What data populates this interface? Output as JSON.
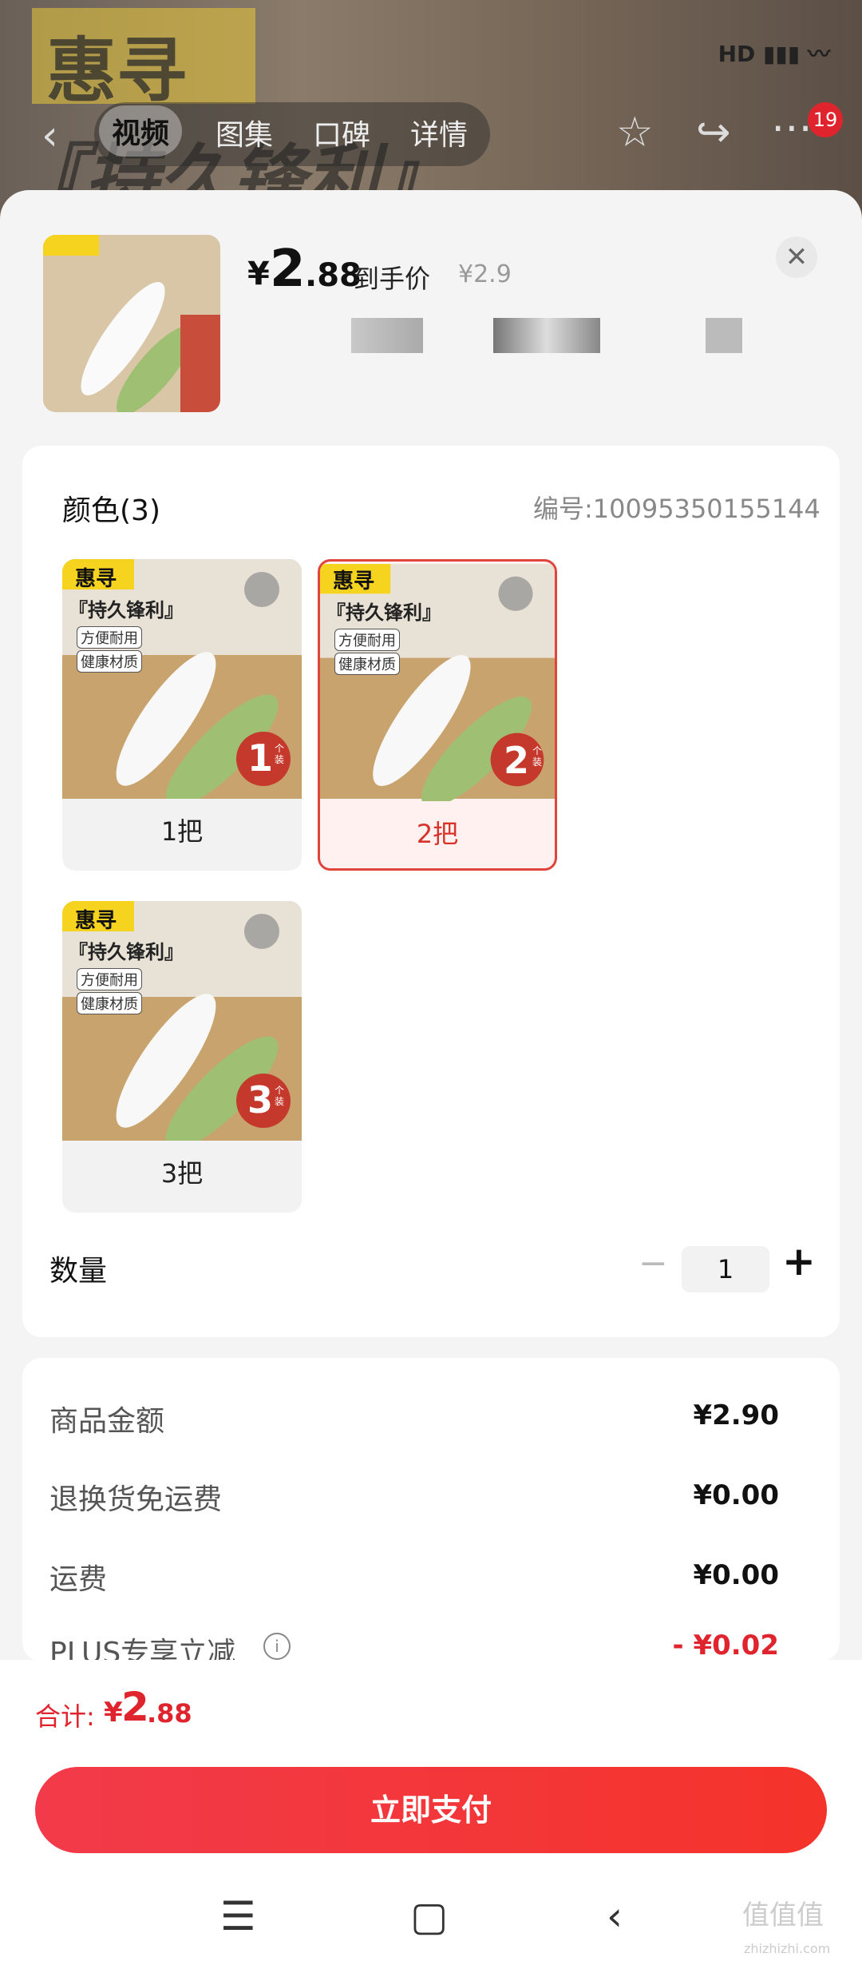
{
  "hero": {
    "brand": "惠寻",
    "slogan": "『持久锋利』"
  },
  "status": {
    "icons": "HD ▮▮▮ 〰"
  },
  "nav": {
    "tabs": [
      "视频",
      "图集",
      "口碑",
      "详情"
    ],
    "active_tab": "视频",
    "badge": "19"
  },
  "product": {
    "price_symbol": "¥",
    "price_int": "2",
    "price_dec": ".88",
    "price_label": "到手价",
    "original_price": "¥2.9"
  },
  "sku": {
    "section_title": "颜色(3)",
    "number": "编号:10095350155144",
    "brand": "惠寻",
    "slogan": "『持久锋利』",
    "tag1": "方便耐用",
    "tag2": "健康材质",
    "options": [
      {
        "label": "1把",
        "count": "1",
        "unit": "个装",
        "selected": false
      },
      {
        "label": "2把",
        "count": "2",
        "unit": "个装",
        "selected": true
      },
      {
        "label": "3把",
        "count": "3",
        "unit": "个装",
        "selected": false
      }
    ]
  },
  "quantity": {
    "title": "数量",
    "value": "1",
    "minus": "−",
    "plus": "+"
  },
  "fees": [
    {
      "label": "商品金额",
      "value": "¥2.90"
    },
    {
      "label": "退换货免运费",
      "value": "¥0.00"
    },
    {
      "label": "运费",
      "value": "¥0.00"
    }
  ],
  "plus": {
    "label": "PLUS专享立减",
    "value": "- ¥0.02"
  },
  "total": {
    "label": "合计:",
    "symbol": "¥",
    "int": "2",
    "dec": ".88"
  },
  "pay_button": "立即支付",
  "watermark": {
    "main": "值值值",
    "sub": "zhizhizhi.com"
  }
}
